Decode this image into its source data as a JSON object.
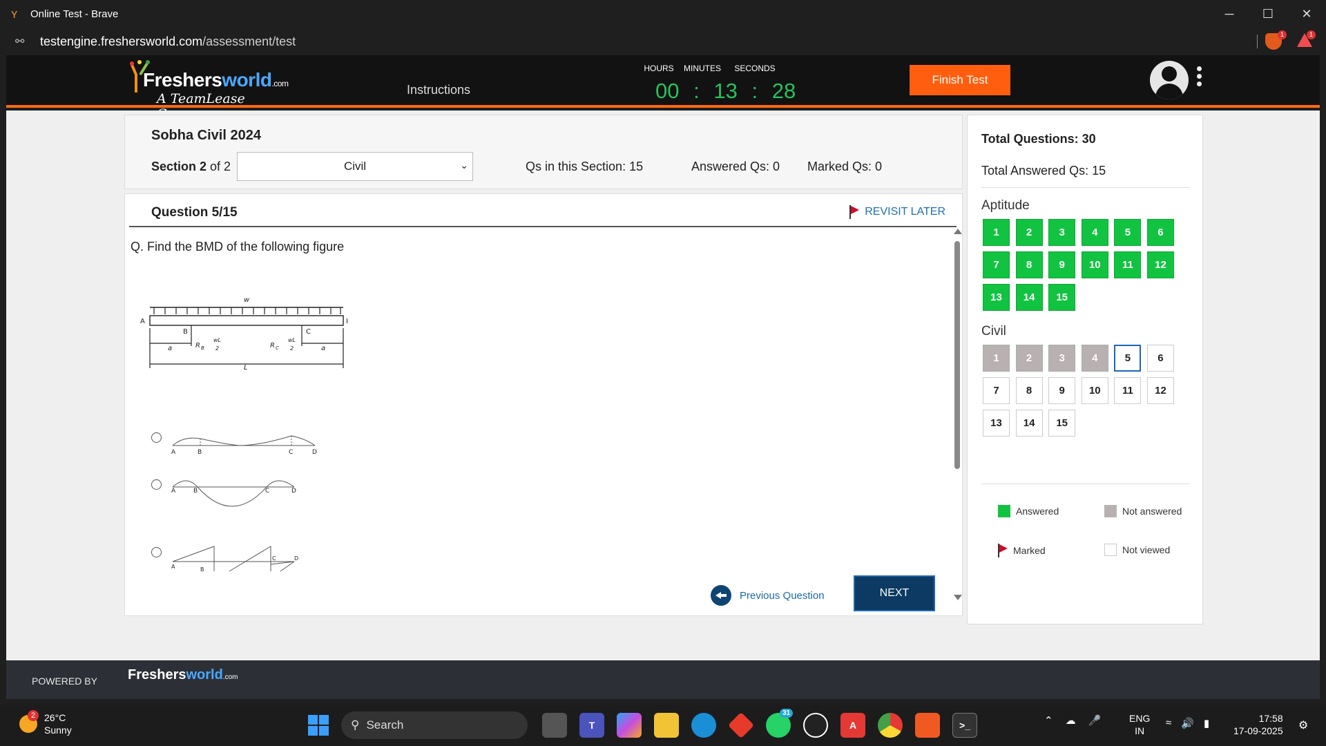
{
  "browser": {
    "window_title": "Online Test - Brave",
    "url_host": "testengine.freshersworld.com",
    "url_path": "/assessment/test",
    "shield_count": "1",
    "rewards_count": "1"
  },
  "header": {
    "logo_brand_a": "Freshers",
    "logo_brand_b": "world",
    "logo_com": ".com",
    "logo_tagline": "A TeamLease Company",
    "instructions": "Instructions",
    "timer": {
      "hours_label": "HOURS",
      "minutes_label": "MINUTES",
      "seconds_label": "SECONDS",
      "hours": "00",
      "minutes": "13",
      "seconds": "28",
      "sep": ":"
    },
    "finish_label": "Finish Test"
  },
  "section": {
    "test_name": "Sobha Civil 2024",
    "section_prefix": "Section 2",
    "section_of": " of 2",
    "selected": "Civil",
    "qs_in_section": "Qs in this Section: 15",
    "answered": "Answered Qs: 0",
    "marked": "Marked Qs: 0"
  },
  "question": {
    "number": "Question 5/15",
    "revisit_label": "REVISIT LATER",
    "text": "Q. Find the BMD of the following figure",
    "figure_labels": {
      "w": "w",
      "A": "A",
      "B": "B",
      "C": "C",
      "D": "D",
      "a": "a",
      "L": "L",
      "RB": "R",
      "RB_sub": "B",
      "RC": "R",
      "RC_sub": "C",
      "wL": "wL",
      "two": "2"
    },
    "option_labels": {
      "A": "A",
      "B": "B",
      "C": "C",
      "D": "D"
    },
    "prev_label": "Previous Question",
    "next_label": "NEXT"
  },
  "palette": {
    "total_questions": "Total Questions: 30",
    "total_answered": "Total Answered Qs: 15",
    "groups": [
      {
        "title": "Aptitude",
        "items": [
          {
            "n": "1",
            "state": "answered"
          },
          {
            "n": "2",
            "state": "answered"
          },
          {
            "n": "3",
            "state": "answered"
          },
          {
            "n": "4",
            "state": "answered"
          },
          {
            "n": "5",
            "state": "answered"
          },
          {
            "n": "6",
            "state": "answered"
          },
          {
            "n": "7",
            "state": "answered"
          },
          {
            "n": "8",
            "state": "answered"
          },
          {
            "n": "9",
            "state": "answered"
          },
          {
            "n": "10",
            "state": "answered"
          },
          {
            "n": "11",
            "state": "answered"
          },
          {
            "n": "12",
            "state": "answered"
          },
          {
            "n": "13",
            "state": "answered"
          },
          {
            "n": "14",
            "state": "answered"
          },
          {
            "n": "15",
            "state": "answered"
          }
        ]
      },
      {
        "title": "Civil",
        "items": [
          {
            "n": "1",
            "state": "notanswered"
          },
          {
            "n": "2",
            "state": "notanswered"
          },
          {
            "n": "3",
            "state": "notanswered"
          },
          {
            "n": "4",
            "state": "notanswered"
          },
          {
            "n": "5",
            "state": "current"
          },
          {
            "n": "6",
            "state": "notviewed"
          },
          {
            "n": "7",
            "state": "notviewed"
          },
          {
            "n": "8",
            "state": "notviewed"
          },
          {
            "n": "9",
            "state": "notviewed"
          },
          {
            "n": "10",
            "state": "notviewed"
          },
          {
            "n": "11",
            "state": "notviewed"
          },
          {
            "n": "12",
            "state": "notviewed"
          },
          {
            "n": "13",
            "state": "notviewed"
          },
          {
            "n": "14",
            "state": "notviewed"
          },
          {
            "n": "15",
            "state": "notviewed"
          }
        ]
      }
    ],
    "legend": {
      "answered": "Answered",
      "not_answered": "Not answered",
      "marked": "Marked",
      "not_viewed": "Not viewed"
    },
    "colors": {
      "answered": "#12c341",
      "not_answered": "#b9b1b1",
      "current": "#1b67b8",
      "accent": "#ff5e0e"
    }
  },
  "footer": {
    "powered_by": "POWERED BY",
    "logo_a": "Freshers",
    "logo_b": "world",
    "logo_com": ".com"
  },
  "taskbar": {
    "weather_badge": "2",
    "temperature": "26°C",
    "condition": "Sunny",
    "search_label": "Search",
    "whatsapp_badge": "31",
    "lang_top": "ENG",
    "lang_bottom": "IN",
    "time": "17:58",
    "date": "17-09-2025"
  }
}
